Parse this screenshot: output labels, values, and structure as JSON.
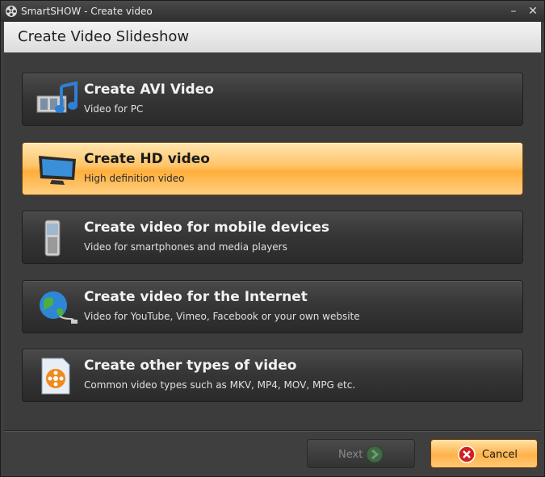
{
  "window": {
    "title": "SmartSHOW - Create video",
    "controls": {
      "minimize_icon": "minimize-icon",
      "close_icon": "close-icon"
    }
  },
  "header": {
    "title": "Create Video Slideshow"
  },
  "options": [
    {
      "title": "Create AVI Video",
      "subtitle": "Video for PC",
      "icon": "film-music-icon",
      "selected": false
    },
    {
      "title": "Create HD video",
      "subtitle": "High definition video",
      "icon": "monitor-icon",
      "selected": true
    },
    {
      "title": "Create video for mobile devices",
      "subtitle": "Video for smartphones and media players",
      "icon": "phone-icon",
      "selected": false
    },
    {
      "title": "Create video for the Internet",
      "subtitle": "Video for YouTube, Vimeo, Facebook or your own website",
      "icon": "globe-icon",
      "selected": false
    },
    {
      "title": "Create other types of video",
      "subtitle": "Common video types such as MKV, MP4, MOV, MPG etc.",
      "icon": "video-file-icon",
      "selected": false
    }
  ],
  "footer": {
    "next_label": "Next",
    "cancel_label": "Cancel"
  },
  "colors": {
    "accent": "#ffb84d",
    "dark_bg": "#3c3c3c"
  }
}
